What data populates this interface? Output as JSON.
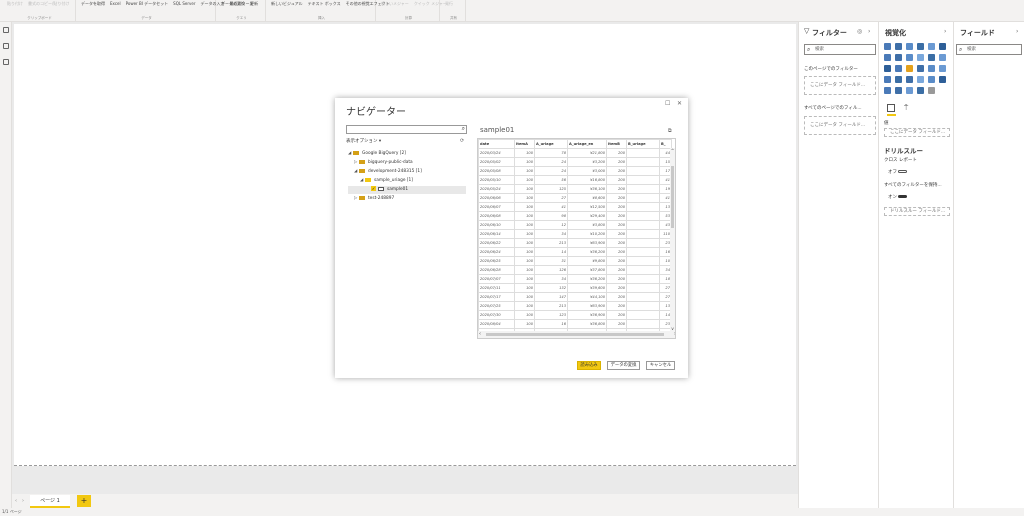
{
  "ribbon": {
    "groups": [
      {
        "label": "クリップボード",
        "buttons": [
          "貼り付け",
          "書式のコピー/貼り付け"
        ],
        "faded": true
      },
      {
        "label": "データ",
        "buttons": [
          "データを取得",
          "Excel",
          "Power BI データセット",
          "SQL Server",
          "データの入力",
          "最近のソース"
        ]
      },
      {
        "label": "クエリ",
        "buttons": [
          "データの変換",
          "更新"
        ]
      },
      {
        "label": "挿入",
        "buttons": [
          "新しいビジュアル",
          "テキスト ボックス",
          "その他の視覚エフェクト"
        ]
      },
      {
        "label": "計算",
        "buttons": [
          "新しいメジャー",
          "クイック メジャー"
        ],
        "faded": true
      },
      {
        "label": "共有",
        "buttons": [
          "発行"
        ],
        "faded": true
      }
    ]
  },
  "tabs": {
    "page1": "ページ 1",
    "add": "+"
  },
  "status": "1/1 ページ",
  "filters": {
    "title": "フィルター",
    "search_placeholder": "検索",
    "this_page": "このページでのフィルター",
    "add_fields": "ここにデータ フィールド...",
    "all_pages": "すべてのページでのフィル...",
    "add_fields2": "ここにデータ フィールド..."
  },
  "viz": {
    "title": "視覚化",
    "values_label": "値",
    "values_placeholder": "ここにデータ フィールド...",
    "drillthrough": "ドリルスルー",
    "cross_report": "クロス レポート",
    "cross_report_state": "オフ",
    "keep_all_filters": "すべてのフィルターを保持...",
    "keep_all_state": "オン",
    "drillthrough_placeholder": "ドリルスルー フィールド..."
  },
  "fields": {
    "title": "フィールド",
    "search_placeholder": "検索"
  },
  "navigator": {
    "title": "ナビゲーター",
    "display_options": "表示オプション ▾",
    "tree": [
      {
        "label": "Google BigQuery [2]",
        "indent": 0,
        "twisty": "◢",
        "icon": "db"
      },
      {
        "label": "bigquery-public-data",
        "indent": 1,
        "twisty": "▷",
        "icon": "db"
      },
      {
        "label": "development-248315 [1]",
        "indent": 1,
        "twisty": "◢",
        "icon": "db"
      },
      {
        "label": "sample_uriage [1]",
        "indent": 2,
        "twisty": "◢",
        "icon": "folder"
      },
      {
        "label": "sample01",
        "indent": 3,
        "twisty": "",
        "icon": "table",
        "checked": true,
        "selected": true
      },
      {
        "label": "test-248897",
        "indent": 1,
        "twisty": "▷",
        "icon": "db"
      }
    ],
    "preview_title": "sample01",
    "columns": [
      "date",
      "itemA",
      "A_uriage",
      "A_uriage_en",
      "itemB",
      "B_uriage",
      "B_"
    ],
    "rows": [
      [
        "2020/03/24",
        "100",
        "78",
        "¥21,800",
        "200",
        "44"
      ],
      [
        "2020/05/02",
        "100",
        "24",
        "¥3,200",
        "200",
        "15"
      ],
      [
        "2020/05/08",
        "100",
        "24",
        "¥3,000",
        "200",
        "17"
      ],
      [
        "2020/05/10",
        "100",
        "56",
        "¥16,800",
        "200",
        "41"
      ],
      [
        "2020/05/24",
        "100",
        "125",
        "¥36,100",
        "200",
        "19"
      ],
      [
        "2020/06/06",
        "100",
        "27",
        "¥8,600",
        "200",
        "41"
      ],
      [
        "2020/06/07",
        "100",
        "41",
        "¥12,500",
        "200",
        "13"
      ],
      [
        "2020/06/08",
        "100",
        "98",
        "¥29,400",
        "200",
        "53"
      ],
      [
        "2020/06/10",
        "100",
        "12",
        "¥3,800",
        "200",
        "43"
      ],
      [
        "2020/06/14",
        "100",
        "34",
        "¥10,200",
        "200",
        "110"
      ],
      [
        "2020/06/22",
        "100",
        "213",
        "¥63,900",
        "200",
        "23"
      ],
      [
        "2020/06/24",
        "100",
        "14",
        "¥36,200",
        "200",
        "16"
      ],
      [
        "2020/06/25",
        "100",
        "31",
        "¥9,800",
        "200",
        "10"
      ],
      [
        "2020/06/28",
        "100",
        "126",
        "¥37,800",
        "200",
        "34"
      ],
      [
        "2020/07/07",
        "100",
        "34",
        "¥36,200",
        "200",
        "18"
      ],
      [
        "2020/07/11",
        "100",
        "132",
        "¥39,600",
        "200",
        "27"
      ],
      [
        "2020/07/17",
        "100",
        "147",
        "¥44,100",
        "200",
        "27"
      ],
      [
        "2020/07/25",
        "100",
        "213",
        "¥63,900",
        "200",
        "13"
      ],
      [
        "2020/07/30",
        "100",
        "123",
        "¥36,900",
        "200",
        "14"
      ],
      [
        "2020/08/04",
        "100",
        "16",
        "¥36,800",
        "200",
        "23"
      ],
      [
        "2020/08/10",
        "100",
        "218",
        "¥65,400",
        "200",
        "45"
      ],
      [
        "2020/08/12",
        "100",
        "56",
        "¥16,800",
        "200",
        "34"
      ],
      [
        "2020/08/15",
        "100",
        "112",
        "¥33,300",
        "200",
        "10"
      ]
    ],
    "buttons": {
      "load": "読み込み",
      "transform": "データの変換",
      "cancel": "キャンセル"
    }
  }
}
